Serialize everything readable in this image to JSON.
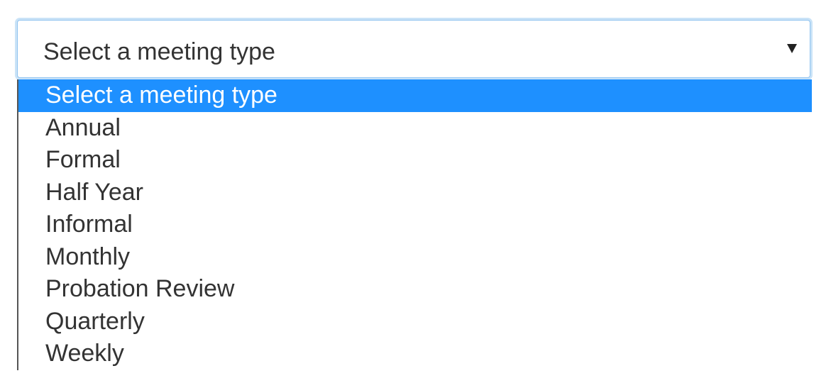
{
  "colors": {
    "highlight": "#1e90ff",
    "focus_border": "#8fc3f0",
    "text": "#333333"
  },
  "select": {
    "selected_label": "Select a meeting type",
    "caret_icon": "triangle-down-icon"
  },
  "dropdown": {
    "highlighted_index": 0,
    "options": [
      {
        "label": "Select a meeting type"
      },
      {
        "label": "Annual"
      },
      {
        "label": "Formal"
      },
      {
        "label": "Half Year"
      },
      {
        "label": "Informal"
      },
      {
        "label": "Monthly"
      },
      {
        "label": "Probation Review"
      },
      {
        "label": "Quarterly"
      },
      {
        "label": "Weekly"
      }
    ]
  }
}
